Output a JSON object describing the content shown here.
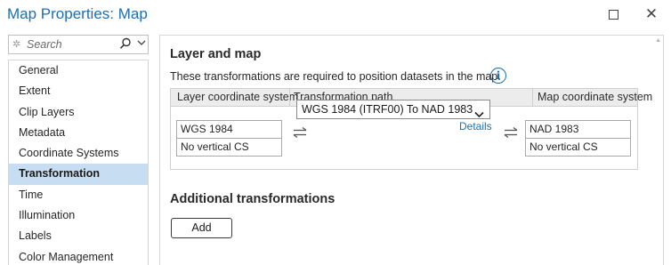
{
  "window": {
    "title": "Map Properties: Map"
  },
  "sidebar": {
    "search_placeholder": "Search",
    "items": [
      {
        "label": "General"
      },
      {
        "label": "Extent"
      },
      {
        "label": "Clip Layers"
      },
      {
        "label": "Metadata"
      },
      {
        "label": "Coordinate Systems"
      },
      {
        "label": "Transformation",
        "selected": true
      },
      {
        "label": "Time"
      },
      {
        "label": "Illumination"
      },
      {
        "label": "Labels"
      },
      {
        "label": "Color Management"
      }
    ]
  },
  "main": {
    "section_title": "Layer and map",
    "description": "These transformations are required to position datasets in the map.",
    "table": {
      "headers": [
        "Layer coordinate system",
        "Transformation path",
        "Map coordinate system"
      ],
      "layer_horizontal": "WGS 1984",
      "layer_vertical": "No vertical CS",
      "transformation": "WGS 1984 (ITRF00) To NAD 1983",
      "details_link": "Details",
      "map_horizontal": "NAD 1983",
      "map_vertical": "No vertical CS"
    },
    "additional_title": "Additional transformations",
    "add_button": "Add"
  },
  "colors": {
    "accent": "#1c6fb0",
    "selected_nav": "#c7ddf1",
    "header_bg": "#ececec"
  },
  "icons": [
    "restore-icon",
    "close-icon",
    "search-sparkle-icon",
    "magnifier-icon",
    "chevron-down-icon",
    "info-icon",
    "swap-arrows-icon",
    "scroll-up-icon"
  ]
}
